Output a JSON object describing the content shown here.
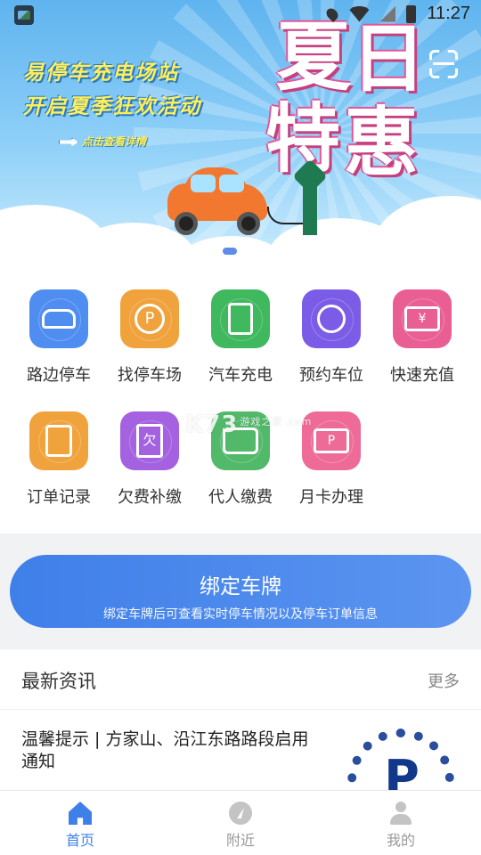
{
  "status_bar": {
    "time": "11:27"
  },
  "banner": {
    "line1": "易停车充电场站",
    "line2": "开启夏季狂欢活动",
    "link": "点击查看详情",
    "big_title": [
      "夏",
      "日",
      "特",
      "惠"
    ],
    "slide_count": 3,
    "active_slide": 1
  },
  "grid": {
    "items": [
      {
        "label": "路边停车",
        "icon": "car-icon",
        "color": "#4f8df1"
      },
      {
        "label": "找停车场",
        "icon": "parking-search-icon",
        "color": "#f0a33c",
        "glyph": "P"
      },
      {
        "label": "汽车充电",
        "icon": "charging-station-icon",
        "color": "#3fb85e"
      },
      {
        "label": "预约车位",
        "icon": "reservation-clock-icon",
        "color": "#7a5ce6"
      },
      {
        "label": "快速充值",
        "icon": "recharge-ticket-icon",
        "color": "#ea5f93",
        "glyph": "¥"
      },
      {
        "label": "订单记录",
        "icon": "order-list-icon",
        "color": "#f0a33c"
      },
      {
        "label": "欠费补缴",
        "icon": "arrears-receipt-icon",
        "color": "#a461e0",
        "glyph": "欠"
      },
      {
        "label": "代人缴费",
        "icon": "wallet-icon",
        "color": "#52b86a"
      },
      {
        "label": "月卡办理",
        "icon": "monthly-card-icon",
        "color": "#ee6b97",
        "glyph": "P"
      }
    ]
  },
  "watermark": {
    "text": "K73",
    "sub": "游戏之家",
    "domain": ".com"
  },
  "bind": {
    "title": "绑定车牌",
    "subtitle": "绑定车牌后可查看实时停车情况以及停车订单信息"
  },
  "news": {
    "title": "最新资讯",
    "more": "更多",
    "items": [
      {
        "text": "温馨提示 | 方家山、沿江东路路段启用通知",
        "thumb_glyph": "P"
      }
    ]
  },
  "bottom_nav": {
    "items": [
      {
        "label": "首页",
        "icon": "home-icon",
        "active": true
      },
      {
        "label": "附近",
        "icon": "compass-icon",
        "active": false
      },
      {
        "label": "我的",
        "icon": "user-icon",
        "active": false
      }
    ]
  },
  "colors": {
    "accent": "#3f7fe9",
    "banner_sky": "#5fb4ef",
    "banner_text": "#ffef5a"
  }
}
